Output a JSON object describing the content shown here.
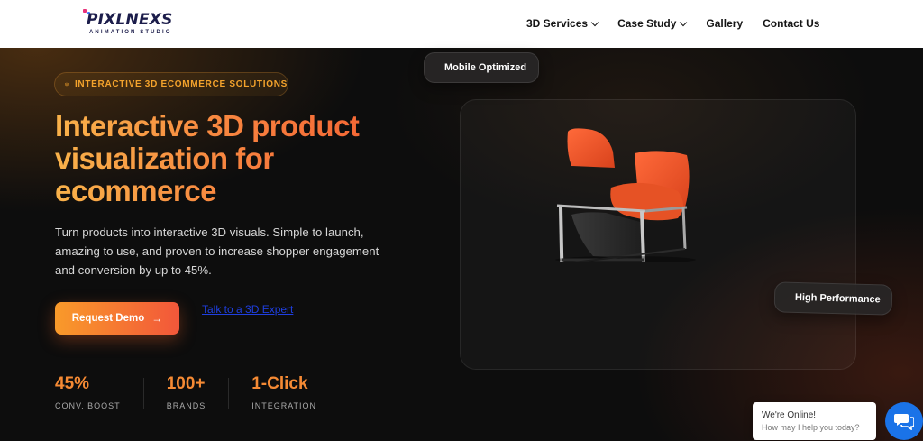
{
  "brand": {
    "name": "PIXLNEXS",
    "tagline": "ANIMATION STUDIO",
    "colors": {
      "navy": "#1c1d4b",
      "pink": "#e8327a",
      "blue": "#3a7bff"
    }
  },
  "nav": {
    "items": [
      {
        "label": "3D Services",
        "dropdown": true
      },
      {
        "label": "Case Study",
        "dropdown": true
      },
      {
        "label": "Gallery",
        "dropdown": false
      },
      {
        "label": "Contact Us",
        "dropdown": false
      }
    ]
  },
  "hero": {
    "badge": {
      "icon": "cube-icon",
      "text": "INTERACTIVE 3D ECOMMERCE SOLUTIONS"
    },
    "headline": [
      "Interactive 3D product",
      "visualization for",
      "ecommerce"
    ],
    "description": [
      "Turn products into interactive 3D visuals. Simple to launch,",
      "amazing to use, and proven to increase shopper engagement",
      "and conversion by up to 45%."
    ],
    "cta_primary": "Request Demo",
    "cta_secondary": "Talk to a 3D Expert",
    "stats": [
      {
        "value": "45%",
        "label": "CONV. BOOST"
      },
      {
        "value": "100+",
        "label": "BRANDS"
      },
      {
        "value": "1-Click",
        "label": "INTEGRATION"
      }
    ],
    "accent_gradient": [
      "#f9b24a",
      "#f25a2f"
    ]
  },
  "showcase": {
    "pill_mobile": {
      "icon": "check-circle-icon",
      "label": "Mobile Optimized"
    },
    "pill_performance": {
      "icon": "lightning-icon",
      "label": "High Performance"
    },
    "product_image": "armchair-3d-model"
  },
  "chat": {
    "line1": "We're Online!",
    "line2": "How may I help you today?",
    "icon": "chat-bubbles-icon",
    "color": "#1a73e8"
  }
}
